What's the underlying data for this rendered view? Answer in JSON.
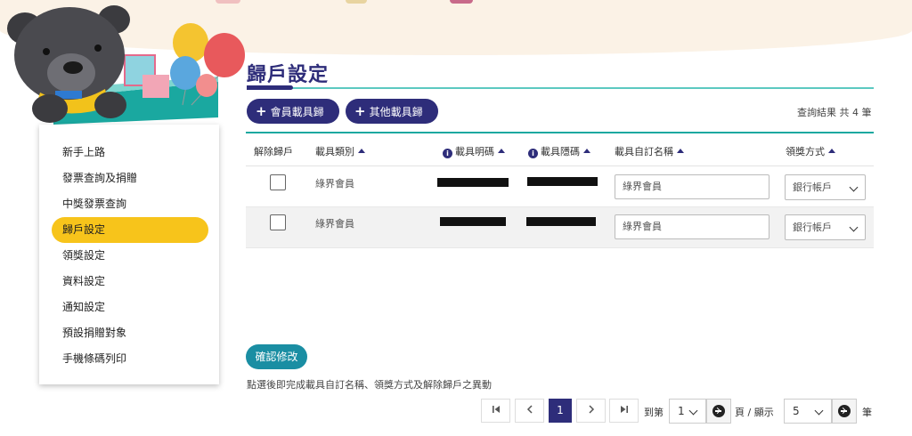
{
  "page_title": "歸戶設定",
  "sidebar": {
    "items": [
      {
        "label": "新手上路",
        "active": false
      },
      {
        "label": "發票查詢及捐贈",
        "active": false
      },
      {
        "label": "中獎發票查詢",
        "active": false
      },
      {
        "label": "歸戶設定",
        "active": true
      },
      {
        "label": "領獎設定",
        "active": false
      },
      {
        "label": "資料設定",
        "active": false
      },
      {
        "label": "通知設定",
        "active": false
      },
      {
        "label": "預設捐贈對象",
        "active": false
      },
      {
        "label": "手機條碼列印",
        "active": false
      }
    ]
  },
  "toolbar": {
    "member_carrier_btn": "會員載具歸戶",
    "other_carrier_btn": "其他載具歸戶",
    "result_count": "查詢結果 共 4 筆"
  },
  "table": {
    "headers": {
      "unbind": "解除歸戶",
      "carrier_type": "載具類別",
      "carrier_visible": "載具明碼",
      "carrier_hidden": "載具隱碼",
      "custom_name": "載具自訂名稱",
      "prize_method": "領獎方式"
    },
    "rows": [
      {
        "carrier_type": "綠界會員",
        "custom_name": "綠界會員",
        "prize_method": "銀行帳戶"
      },
      {
        "carrier_type": "綠界會員",
        "custom_name": "綠界會員",
        "prize_method": "銀行帳戶"
      }
    ]
  },
  "confirm_button": "確認修改",
  "hint_text": "點選後即完成載具自訂名稱、領獎方式及解除歸戶之異動",
  "pagination": {
    "current_page": "1",
    "goto_label": "到第",
    "goto_value": "1",
    "page_label": "頁 / 顯示",
    "per_page_value": "5",
    "unit_label": "筆"
  },
  "colors": {
    "brand_navy": "#2e2d7a",
    "teal": "#1aa8a0",
    "active_yellow": "#f7c41b",
    "confirm_blue": "#1a8ea3"
  }
}
